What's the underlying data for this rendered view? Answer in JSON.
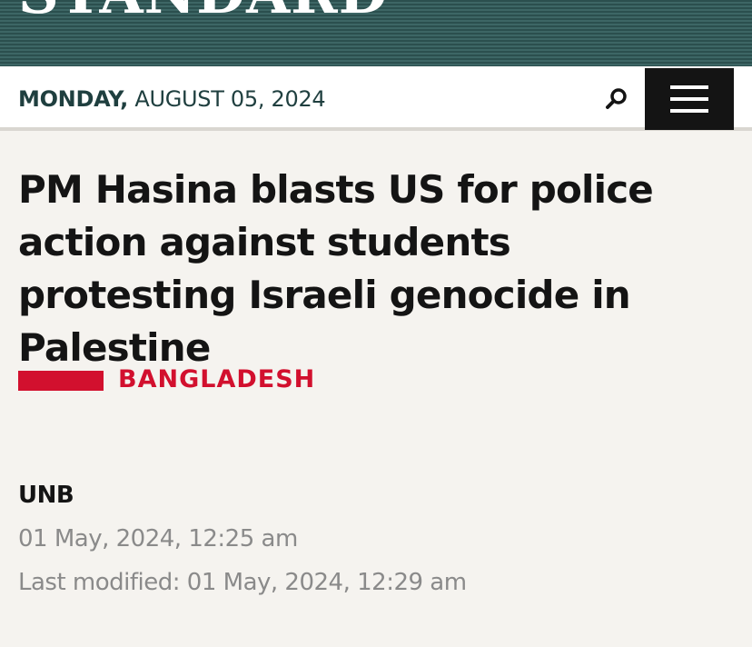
{
  "masthead": {
    "logo_text": "STANDARD",
    "background_color": "#2f5554"
  },
  "datebar": {
    "day": "MONDAY,",
    "date": "AUGUST 05, 2024",
    "search_icon": "search-icon",
    "menu_icon": "hamburger-menu-icon"
  },
  "article": {
    "headline": "PM Hasina blasts US for police action against students protesting Israeli genocide in Palestine",
    "category": "BANGLADESH",
    "category_color": "#d2102e",
    "author": "UNB",
    "published": "01 May, 2024, 12:25 am",
    "last_modified": "Last modified: 01 May, 2024, 12:29 am"
  }
}
